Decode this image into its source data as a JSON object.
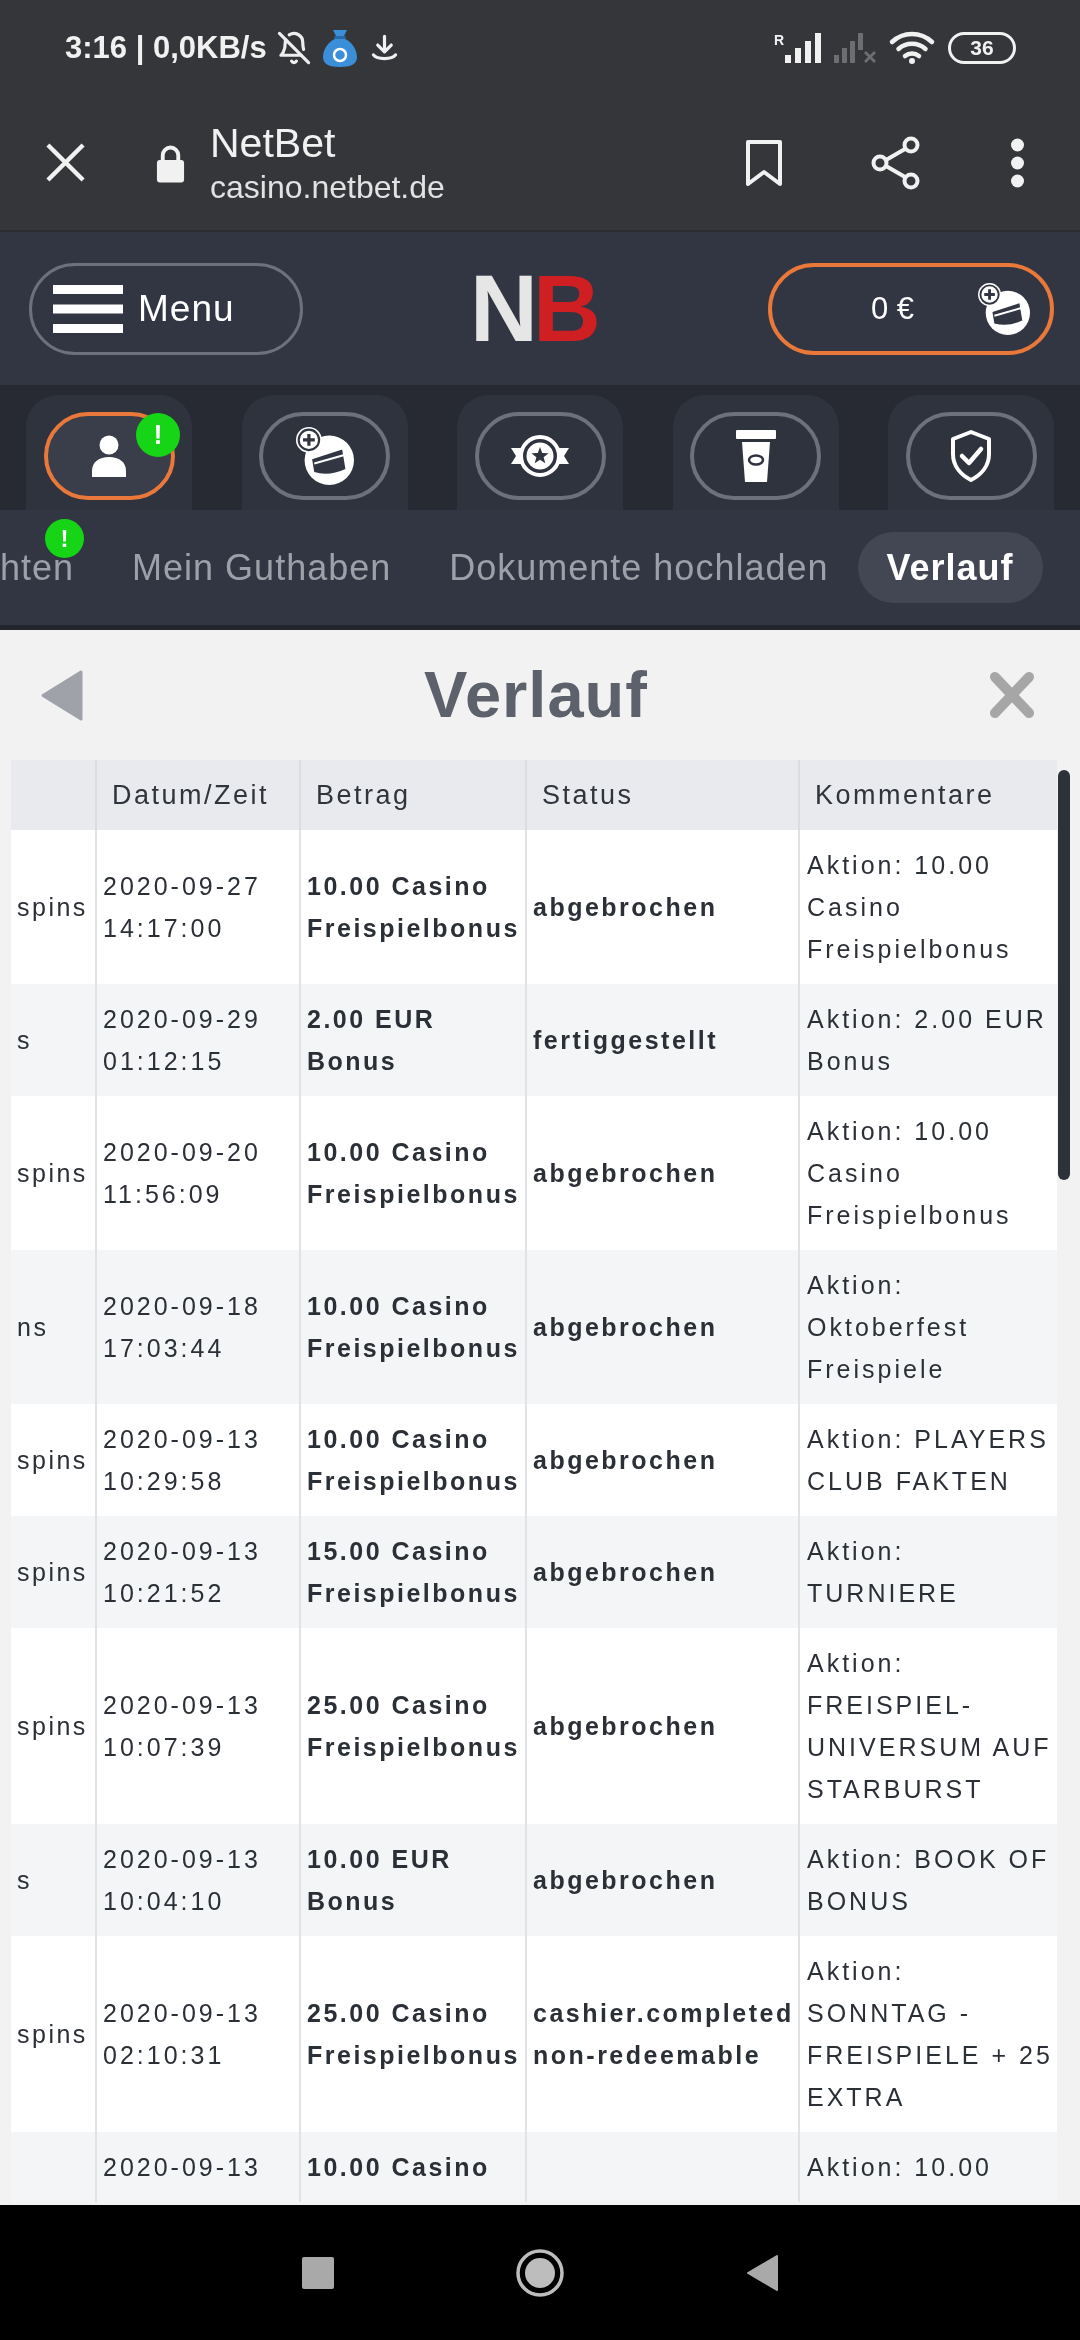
{
  "status_bar": {
    "clock": "3:16 | 0,0KB/s",
    "roaming": "R",
    "battery": "36"
  },
  "browser_bar": {
    "title": "NetBet",
    "url": "casino.netbet.de"
  },
  "header": {
    "menu_label": "Menu",
    "logo_letters": [
      "N",
      "B"
    ],
    "balance": "0 €"
  },
  "account_tabs": [
    {
      "selected": true,
      "badge": "!"
    },
    {
      "selected": false
    },
    {
      "selected": false
    },
    {
      "selected": false
    },
    {
      "selected": false
    }
  ],
  "sub_tabs": [
    {
      "label": "hten",
      "selected": false,
      "badge": "!"
    },
    {
      "label": "Mein Guthaben",
      "selected": false
    },
    {
      "label": "Dokumente hochladen",
      "selected": false
    },
    {
      "label": "Verlauf",
      "selected": true
    }
  ],
  "panel": {
    "title": "Verlauf"
  },
  "table": {
    "columns": [
      "Datum/Zeit",
      "Betrag",
      "Status",
      "Kommentare"
    ],
    "rows": [
      {
        "column_1": "spins",
        "date_time": "2020-09-27 14:17:00",
        "amount": "10.00 Casino Freispielbonus",
        "status": "abgebrochen",
        "comment": "Aktion: 10.00 Casino Freispielbonus"
      },
      {
        "column_1": "s",
        "date_time": "2020-09-29 01:12:15",
        "amount": "2.00 EUR Bonus",
        "status": "fertiggestellt",
        "comment": "Aktion: 2.00 EUR Bonus"
      },
      {
        "column_1": "spins",
        "date_time": "2020-09-20 11:56:09",
        "amount": "10.00 Casino Freispielbonus",
        "status": "abgebrochen",
        "comment": "Aktion: 10.00 Casino Freispielbonus"
      },
      {
        "column_1": "ns",
        "date_time": "2020-09-18 17:03:44",
        "amount": "10.00 Casino Freispielbonus",
        "status": "abgebrochen",
        "comment": "Aktion: Oktoberfest Freispiele"
      },
      {
        "column_1": "spins",
        "date_time": "2020-09-13 10:29:58",
        "amount": "10.00 Casino Freispielbonus",
        "status": "abgebrochen",
        "comment": "Aktion: PLAYERS CLUB FAKTEN"
      },
      {
        "column_1": "spins",
        "date_time": "2020-09-13 10:21:52",
        "amount": "15.00 Casino Freispielbonus",
        "status": "abgebrochen",
        "comment": "Aktion: TURNIERE"
      },
      {
        "column_1": "spins",
        "date_time": "2020-09-13 10:07:39",
        "amount": "25.00 Casino Freispielbonus",
        "status": "abgebrochen",
        "comment": "Aktion: FREISPIEL-UNIVERSUM AUF STARBURST"
      },
      {
        "column_1": "s",
        "date_time": "2020-09-13 10:04:10",
        "amount": "10.00 EUR Bonus",
        "status": "abgebrochen",
        "comment": "Aktion: BOOK OF BONUS"
      },
      {
        "column_1": "spins",
        "date_time": "2020-09-13 02:10:31",
        "amount": "25.00 Casino Freispielbonus",
        "status": "cashier.completed non-redeemable",
        "comment": "Aktion: SONNTAG - FREISPIELE + 25 EXTRA"
      },
      {
        "date_time": "2020-09-13",
        "amount": "10.00 Casino",
        "comment": "Aktion: 10.00"
      }
    ]
  }
}
